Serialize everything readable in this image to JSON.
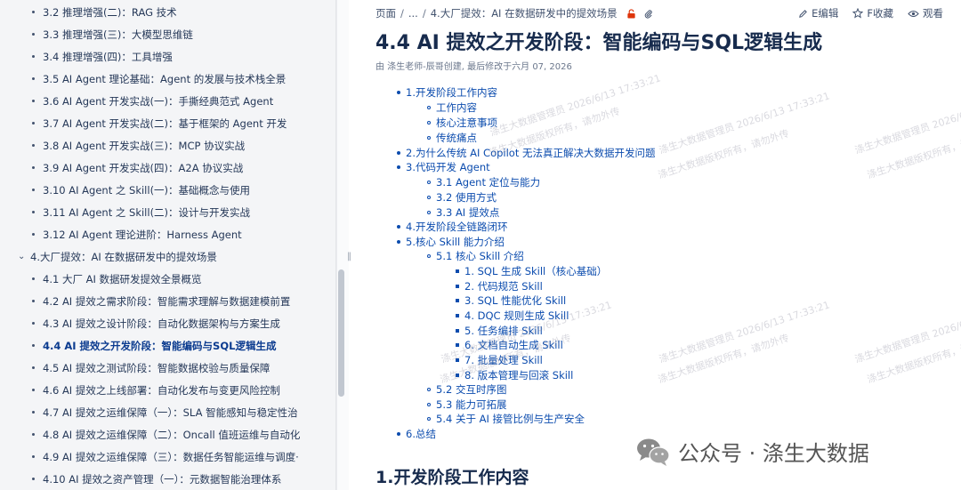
{
  "sidebar": {
    "items": [
      {
        "label": "3.2 推理增强(二)：RAG 技术",
        "level": 2
      },
      {
        "label": "3.3 推理增强(三)：大模型思维链",
        "level": 2
      },
      {
        "label": "3.4 推理增强(四)：工具增强",
        "level": 2
      },
      {
        "label": "3.5 AI Agent 理论基础：Agent 的发展与技术栈全景",
        "level": 2
      },
      {
        "label": "3.6 AI Agent 开发实战(一)：手撕经典范式 Agent",
        "level": 2
      },
      {
        "label": "3.7 AI Agent 开发实战(二)：基于框架的 Agent 开发",
        "level": 2
      },
      {
        "label": "3.8 AI Agent 开发实战(三)：MCP 协议实战",
        "level": 2
      },
      {
        "label": "3.9 AI Agent 开发实战(四)：A2A 协议实战",
        "level": 2
      },
      {
        "label": "3.10 AI Agent 之 Skill(一)：基础概念与使用",
        "level": 2
      },
      {
        "label": "3.11 AI Agent 之 Skill(二)：设计与开发实战",
        "level": 2
      },
      {
        "label": "3.12 AI Agent 理论进阶：Harness Agent",
        "level": 2
      },
      {
        "label": "4.大厂提效：AI 在数据研发中的提效场景",
        "level": 1
      },
      {
        "label": "4.1 大厂 AI 数据研发提效全景概览",
        "level": 2
      },
      {
        "label": "4.2 AI 提效之需求阶段：智能需求理解与数据建模前置",
        "level": 2
      },
      {
        "label": "4.3 AI 提效之设计阶段：自动化数据架构与方案生成",
        "level": 2
      },
      {
        "label": "4.4 AI 提效之开发阶段：智能编码与SQL逻辑生成",
        "level": 2,
        "active": true
      },
      {
        "label": "4.5 AI 提效之测试阶段：智能数据校验与质量保障",
        "level": 2
      },
      {
        "label": "4.6 AI 提效之上线部署：自动化发布与变更风险控制",
        "level": 2
      },
      {
        "label": "4.7 AI 提效之运维保障（一）：SLA 智能感知与稳定性治",
        "level": 2
      },
      {
        "label": "4.8 AI 提效之运维保障（二）：Oncall 值班运维与自动化",
        "level": 2
      },
      {
        "label": "4.9 AI 提效之运维保障（三）：数据任务智能运维与调度·",
        "level": 2
      },
      {
        "label": "4.10 AI 提效之资产管理（一）：元数据智能治理体系",
        "level": 2
      }
    ]
  },
  "breadcrumb": {
    "root": "页面",
    "ellipsis": "...",
    "current": "4.大厂提效：AI 在数据研发中的提效场景"
  },
  "actions": {
    "edit": "E编辑",
    "favorite": "F收藏",
    "watch": "观看"
  },
  "page": {
    "title": "4.4 AI 提效之开发阶段：智能编码与SQL逻辑生成",
    "meta": "由 涤生老师-辰哥创建, 最后修改于六月 07, 2026"
  },
  "toc": [
    {
      "label": "1.开发阶段工作内容",
      "level": 1
    },
    {
      "label": "工作内容",
      "level": 2
    },
    {
      "label": "核心注意事项",
      "level": 2
    },
    {
      "label": "传统痛点",
      "level": 2
    },
    {
      "label": "2.为什么传统 AI Copilot 无法真正解决大数据开发问题",
      "level": 1
    },
    {
      "label": "3.代码开发 Agent",
      "level": 1
    },
    {
      "label": "3.1 Agent 定位与能力",
      "level": 2
    },
    {
      "label": "3.2 使用方式",
      "level": 2
    },
    {
      "label": "3.3 AI 提效点",
      "level": 2
    },
    {
      "label": "4.开发阶段全链路闭环",
      "level": 1
    },
    {
      "label": "5.核心 Skill 能力介绍",
      "level": 1
    },
    {
      "label": "5.1 核心 Skill 介绍",
      "level": 2
    },
    {
      "label": "1. SQL 生成 Skill（核心基础）",
      "level": 3
    },
    {
      "label": "2. 代码规范 Skill",
      "level": 3
    },
    {
      "label": "3. SQL 性能优化 Skill",
      "level": 3
    },
    {
      "label": "4. DQC 规则生成 Skill",
      "level": 3
    },
    {
      "label": "5. 任务编排 Skill",
      "level": 3
    },
    {
      "label": "6. 文档自动生成 Skill",
      "level": 3
    },
    {
      "label": "7. 批量处理 Skill",
      "level": 3
    },
    {
      "label": "8. 版本管理与回滚 Skill",
      "level": 3
    },
    {
      "label": "5.2 交互时序图",
      "level": 2
    },
    {
      "label": "5.3 能力可拓展",
      "level": 2
    },
    {
      "label": "5.4 关于 AI 接管比例与生产安全",
      "level": 2
    },
    {
      "label": "6.总结",
      "level": 1
    }
  ],
  "section": {
    "heading": "1.开发阶段工作内容"
  },
  "watermarks": [
    "涤生大数据管理员 2026/6/13 17:33:21",
    "涤生大数据版权所有，请勿外传"
  ],
  "wechat": {
    "label": "公众号 · 涤生大数据"
  },
  "colors": {
    "link": "#0c4cae",
    "sidebar_bg": "#f4f5f7",
    "active": "#0b3b8f"
  }
}
